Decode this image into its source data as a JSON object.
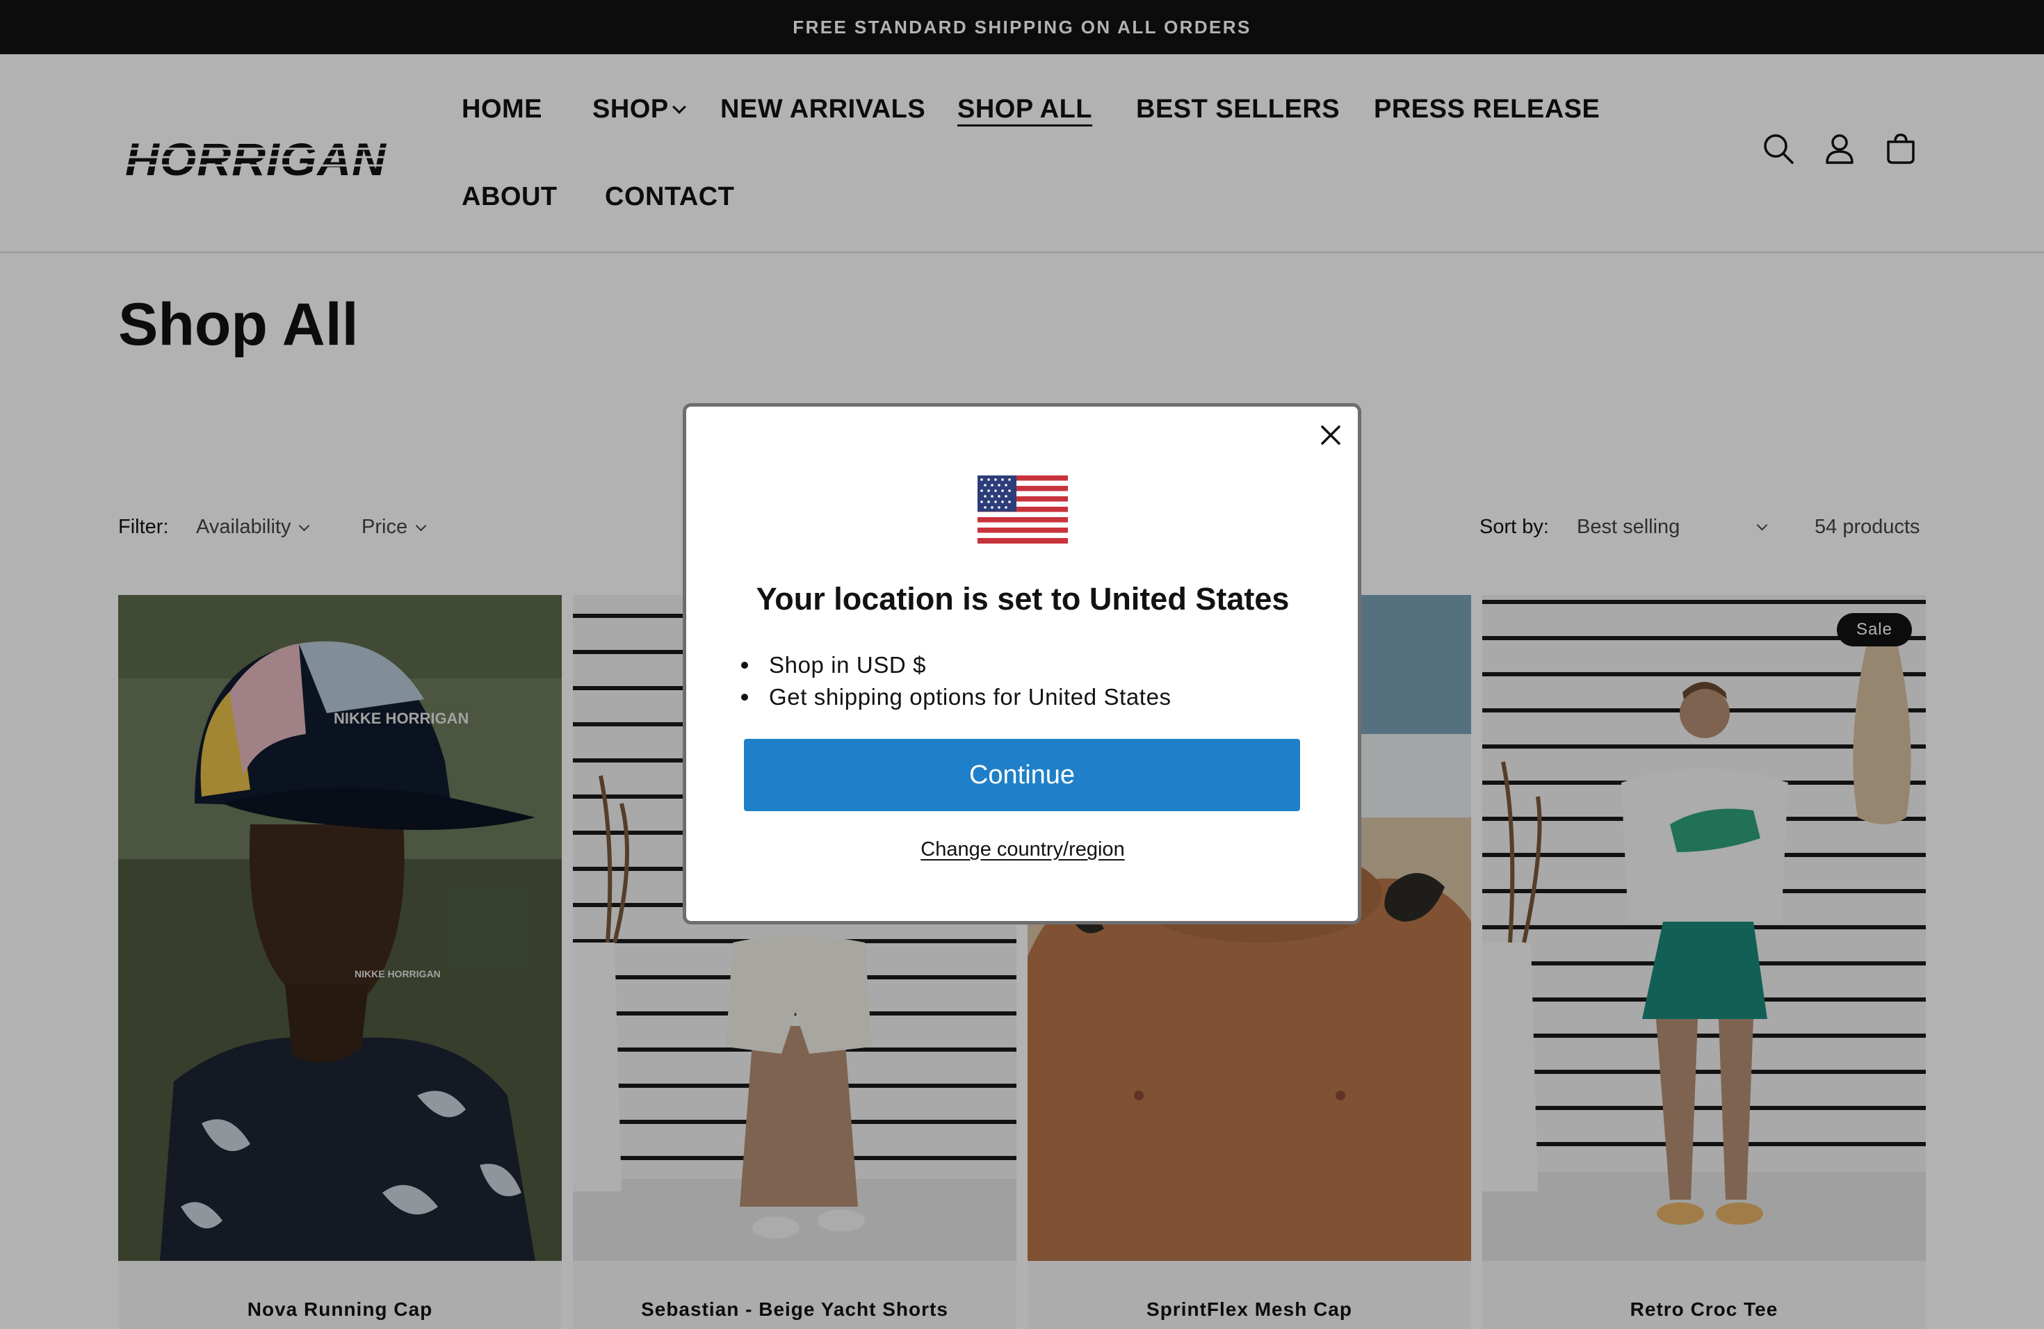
{
  "announcement": {
    "text": "FREE STANDARD SHIPPING ON ALL ORDERS"
  },
  "header": {
    "logo_text": "HORRIGAN",
    "nav": [
      {
        "label": "HOME"
      },
      {
        "label": "SHOP"
      },
      {
        "label": "NEW ARRIVALS"
      },
      {
        "label": "SHOP ALL",
        "active": true
      },
      {
        "label": "BEST SELLERS"
      },
      {
        "label": "PRESS RELEASE"
      },
      {
        "label": "ABOUT"
      },
      {
        "label": "CONTACT"
      }
    ],
    "icons": [
      "search-icon",
      "account-icon",
      "cart-icon"
    ]
  },
  "page": {
    "title": "Shop All"
  },
  "filters": {
    "label": "Filter:",
    "availability": "Availability",
    "price": "Price",
    "sort_label": "Sort by:",
    "sort_value": "Best selling",
    "count": "54 products"
  },
  "products": [
    {
      "title": "Nova Running Cap"
    },
    {
      "title": "Sebastian - Beige Yacht Shorts"
    },
    {
      "title": "SprintFlex Mesh Cap"
    },
    {
      "title": "Retro Croc Tee",
      "badge": "Sale"
    }
  ],
  "modal": {
    "heading": "Your location is set to United States",
    "bullets": [
      "Shop in USD $",
      "Get shipping options for United States"
    ],
    "continue_label": "Continue",
    "change_label": "Change country/region"
  },
  "colors": {
    "announcement_bg": "#121212",
    "continue_button": "#1f7fc8",
    "badge_bg": "#121212"
  }
}
